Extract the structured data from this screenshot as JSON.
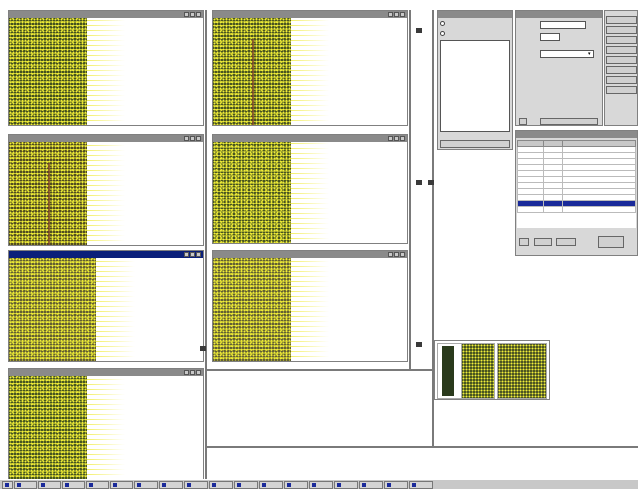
{
  "image_windows": [
    {
      "title": "",
      "active": false
    },
    {
      "title": "",
      "active": false
    },
    {
      "title": "",
      "active": false
    },
    {
      "title": "",
      "active": false
    },
    {
      "title": "",
      "active": true
    },
    {
      "title": "",
      "active": false
    },
    {
      "title": "",
      "active": false
    }
  ],
  "selection_panel": {
    "title": "",
    "list_items": [
      "",
      "",
      "",
      "",
      "",
      "",
      "",
      "",
      "",
      "",
      "",
      ""
    ],
    "button_label": ""
  },
  "control_panel": {
    "title": "",
    "fields": [
      "",
      "",
      ""
    ],
    "buttons": [
      "",
      "",
      "",
      "",
      "",
      "",
      "",
      ""
    ]
  },
  "data_table": {
    "title": "",
    "columns": [
      "",
      "",
      ""
    ],
    "rows": [
      [
        "",
        "",
        ""
      ],
      [
        "",
        "",
        ""
      ],
      [
        "",
        "",
        ""
      ],
      [
        "",
        "",
        ""
      ],
      [
        "",
        "",
        ""
      ],
      [
        "",
        "",
        ""
      ],
      [
        "",
        "",
        ""
      ],
      [
        "",
        "",
        ""
      ],
      [
        "",
        "",
        ""
      ],
      [
        "",
        "",
        ""
      ],
      [
        "",
        "",
        ""
      ]
    ],
    "selected_row": 9,
    "buttons": [
      "",
      "",
      "",
      ""
    ]
  },
  "thumbnail_strip": {
    "count": 3
  },
  "taskbar": {
    "start_label": "",
    "items": [
      "",
      "",
      "",
      "",
      "",
      "",
      "",
      "",
      "",
      "",
      "",
      "",
      "",
      "",
      "",
      "",
      ""
    ]
  },
  "colors": {
    "title_active": "#0a1f7a",
    "title_inactive": "#8a8a8a",
    "point_yellow": "#f2ef3a",
    "selection_blue": "#1a2a9a",
    "chrome_gray": "#d8d8d8"
  }
}
